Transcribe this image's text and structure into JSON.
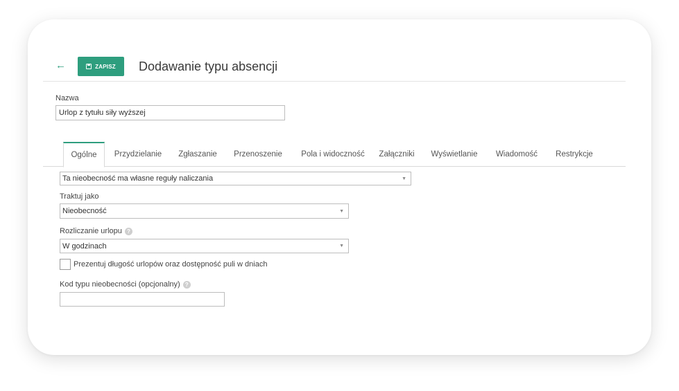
{
  "header": {
    "save_label": "ZAPISZ",
    "title": "Dodawanie typu absencji"
  },
  "name_field": {
    "label": "Nazwa",
    "value": "Urlop z tytułu siły wyższej"
  },
  "tabs": [
    {
      "label": "Ogólne",
      "active": true
    },
    {
      "label": "Przydzielanie",
      "active": false
    },
    {
      "label": "Zgłaszanie",
      "active": false
    },
    {
      "label": "Przenoszenie",
      "active": false
    },
    {
      "label": "Pola i widoczność",
      "active": false
    },
    {
      "label": "Załączniki",
      "active": false
    },
    {
      "label": "Wyświetlanie",
      "active": false
    },
    {
      "label": "Wiadomość",
      "active": false
    },
    {
      "label": "Restrykcje",
      "active": false
    }
  ],
  "form": {
    "accrual_rules": {
      "value": "Ta nieobecność ma własne reguły naliczania"
    },
    "treat_as": {
      "label": "Traktuj jako",
      "value": "Nieobecność"
    },
    "leave_settlement": {
      "label": "Rozliczanie urlopu",
      "value": "W godzinach"
    },
    "present_in_days": {
      "label": "Prezentuj długość urlopów oraz dostępność puli w dniach",
      "checked": false
    },
    "absence_code": {
      "label": "Kod typu nieobecności (opcjonalny)",
      "value": ""
    }
  },
  "colors": {
    "accent": "#2e9e7e"
  },
  "icons": {
    "back": "arrow-left-icon",
    "save": "floppy-disk-icon",
    "help": "question-mark-icon",
    "dropdown": "caret-down-icon"
  }
}
